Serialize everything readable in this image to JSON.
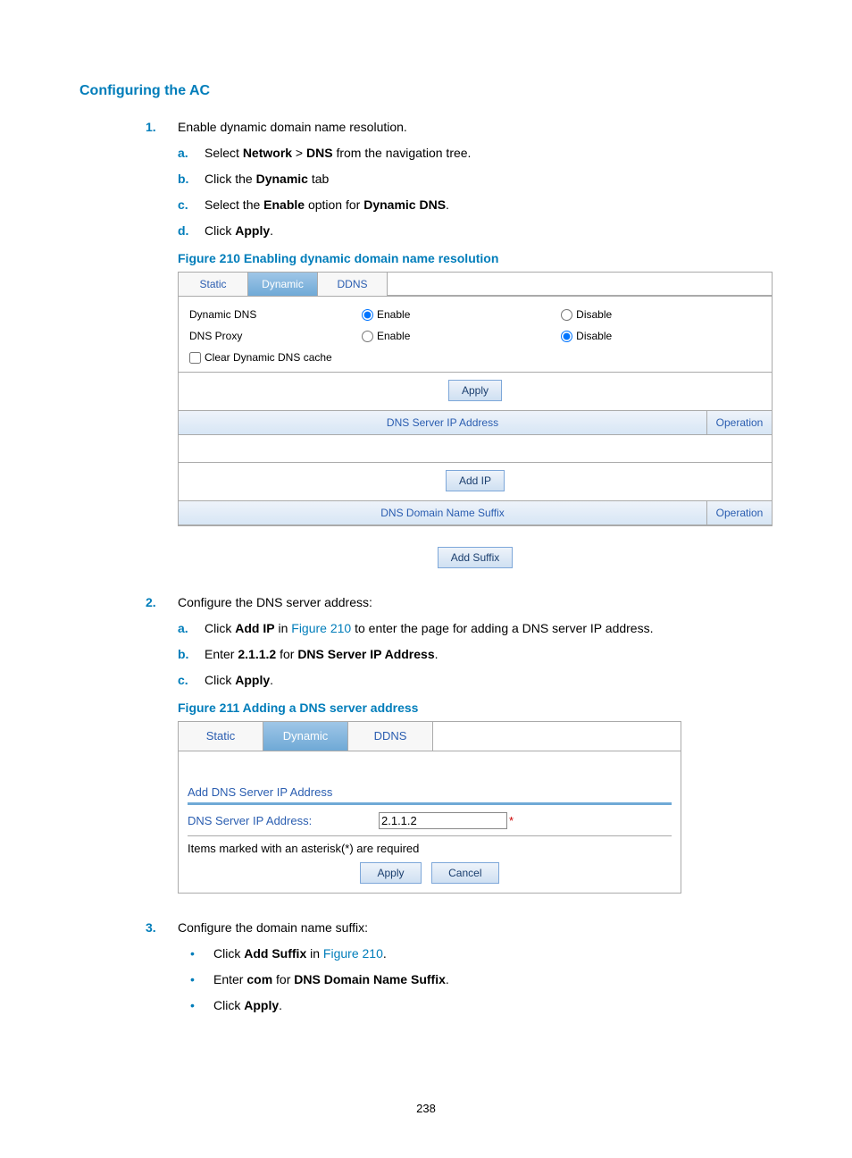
{
  "section_title": "Configuring the AC",
  "step1": {
    "num": "1.",
    "text": "Enable dynamic domain name resolution.",
    "a_marker": "a.",
    "a_pre": "Select ",
    "a_b1": "Network",
    "a_mid": " > ",
    "a_b2": "DNS",
    "a_post": " from the navigation tree.",
    "b_marker": "b.",
    "b_pre": "Click the ",
    "b_b1": "Dynamic",
    "b_post": " tab",
    "c_marker": "c.",
    "c_pre": "Select the ",
    "c_b1": "Enable",
    "c_mid": " option for ",
    "c_b2": "Dynamic DNS",
    "c_post": ".",
    "d_marker": "d.",
    "d_pre": "Click ",
    "d_b1": "Apply",
    "d_post": "."
  },
  "fig210_caption": "Figure 210 Enabling dynamic domain name resolution",
  "fig210": {
    "tab_static": "Static",
    "tab_dynamic": "Dynamic",
    "tab_ddns": "DDNS",
    "row_dyndns": "Dynamic DNS",
    "row_dnsproxy": "DNS Proxy",
    "enable": "Enable",
    "disable": "Disable",
    "clear_cache": "Clear Dynamic DNS cache",
    "apply": "Apply",
    "col_ip": "DNS Server IP Address",
    "col_op": "Operation",
    "add_ip": "Add IP",
    "col_suffix": "DNS Domain Name Suffix",
    "add_suffix": "Add Suffix"
  },
  "step2": {
    "num": "2.",
    "text": "Configure the DNS server address:",
    "a_marker": "a.",
    "a_pre": "Click ",
    "a_b1": "Add IP",
    "a_mid": " in ",
    "a_link": "Figure 210",
    "a_post": " to enter the page for adding a DNS server IP address.",
    "b_marker": "b.",
    "b_pre": "Enter ",
    "b_b1": "2.1.1.2",
    "b_mid": " for ",
    "b_b2": "DNS Server IP Address",
    "b_post": ".",
    "c_marker": "c.",
    "c_pre": "Click ",
    "c_b1": "Apply",
    "c_post": "."
  },
  "fig211_caption": "Figure 211 Adding a DNS server address",
  "fig211": {
    "tab_static": "Static",
    "tab_dynamic": "Dynamic",
    "tab_ddns": "DDNS",
    "group": "Add DNS Server IP Address",
    "label": "DNS Server IP Address:",
    "value": "2.1.1.2",
    "req": "*",
    "note": "Items marked with an asterisk(*) are required",
    "apply": "Apply",
    "cancel": "Cancel"
  },
  "step3": {
    "num": "3.",
    "text": "Configure the domain name suffix:",
    "b1_pre": "Click ",
    "b1_b1": "Add Suffix",
    "b1_mid": " in ",
    "b1_link": "Figure 210",
    "b1_post": ".",
    "b2_pre": "Enter ",
    "b2_b1": "com",
    "b2_mid": " for ",
    "b2_b2": "DNS Domain Name Suffix",
    "b2_post": ".",
    "b3_pre": "Click ",
    "b3_b1": "Apply",
    "b3_post": "."
  },
  "page_number": "238"
}
